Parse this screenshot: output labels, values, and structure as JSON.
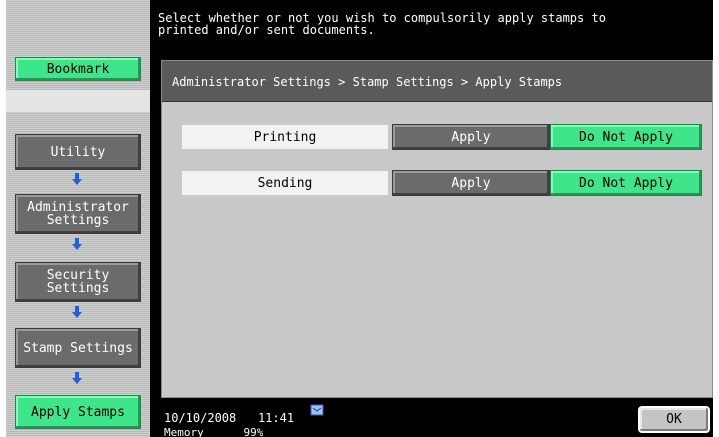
{
  "header": {
    "message": "Select whether or not you wish to compulsorily apply stamps to\nprinted and/or sent documents."
  },
  "sidebar": {
    "bookmark_label": "Bookmark",
    "nav": [
      {
        "label": "Utility"
      },
      {
        "label": "Administrator\nSettings"
      },
      {
        "label": "Security\nSettings"
      },
      {
        "label": "Stamp Settings"
      },
      {
        "label": "Apply Stamps"
      }
    ]
  },
  "main": {
    "breadcrumb": "Administrator Settings > Stamp Settings > Apply Stamps",
    "rows": [
      {
        "label": "Printing",
        "apply_label": "Apply",
        "not_apply_label": "Do Not Apply",
        "selected": "Do Not Apply"
      },
      {
        "label": "Sending",
        "apply_label": "Apply",
        "not_apply_label": "Do Not Apply",
        "selected": "Do Not Apply"
      }
    ]
  },
  "footer": {
    "date": "10/10/2008",
    "time": "11:41",
    "memory_label": "Memory",
    "memory_value": "99%",
    "ok_label": "OK"
  },
  "colors": {
    "selected": "#3fe58a",
    "unselected": "#6b6b6b",
    "arrow": "#1f5fe0"
  }
}
